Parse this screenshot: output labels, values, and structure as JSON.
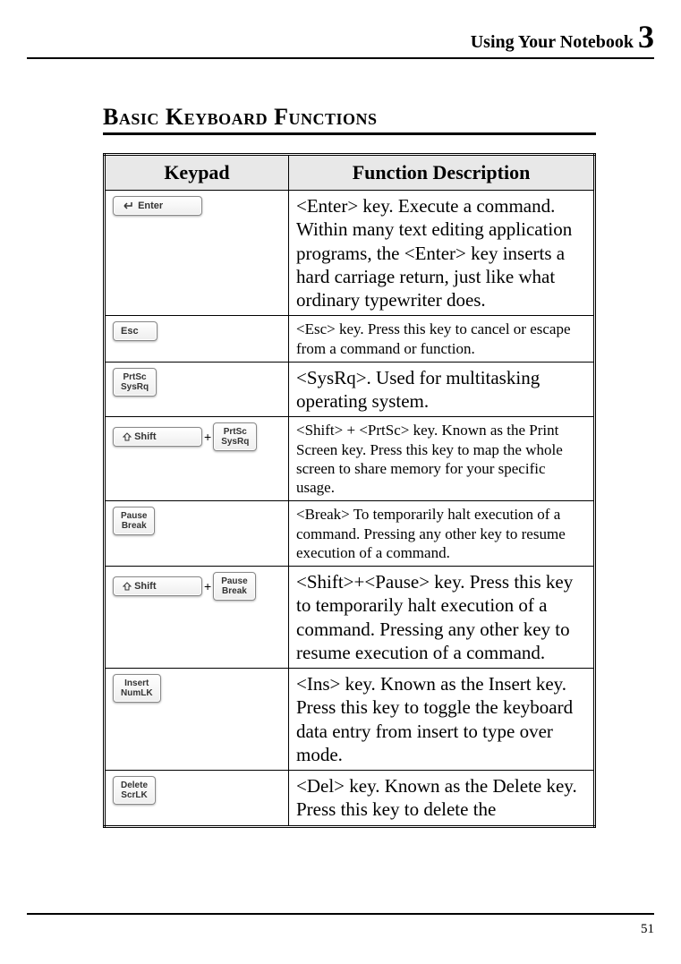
{
  "header": {
    "running_title": "Using Your Notebook",
    "chapter_number": "3"
  },
  "section": {
    "title": "Basic Keyboard Functions"
  },
  "table": {
    "headers": {
      "keypad": "Keypad",
      "desc": "Function Description"
    },
    "rows": [
      {
        "key_labels": [
          "Enter"
        ],
        "size": "large",
        "desc": "<Enter> key. Execute a command. Within many text editing application programs, the <Enter> key inserts a hard carriage return, just like what ordinary typewriter does."
      },
      {
        "key_labels": [
          "Esc"
        ],
        "size": "small",
        "desc": "<Esc> key. Press this key to cancel or escape from a command or function."
      },
      {
        "key_labels": [
          "PrtSc",
          "SysRq"
        ],
        "size": "large",
        "desc": "<SysRq>. Used for multitasking operating system."
      },
      {
        "combo": {
          "left": "Shift",
          "right": [
            "PrtSc",
            "SysRq"
          ]
        },
        "size": "small",
        "desc": "<Shift> + <PrtSc> key. Known as the Print Screen key. Press this key to map the whole screen to share memory for your specific usage."
      },
      {
        "key_labels": [
          "Pause",
          "Break"
        ],
        "size": "small",
        "desc": "<Break> To temporarily halt execution of a command. Pressing any other key to resume execution of a command."
      },
      {
        "combo": {
          "left": "Shift",
          "right": [
            "Pause",
            "Break"
          ]
        },
        "size": "large",
        "desc": "<Shift>+<Pause> key. Press this key to temporarily halt execution of a command. Pressing any other key to resume execution of a command."
      },
      {
        "key_labels": [
          "Insert",
          "NumLK"
        ],
        "size": "large",
        "desc": "<Ins> key. Known as the Insert key. Press this key to toggle the keyboard data entry from insert to type over mode."
      },
      {
        "key_labels": [
          "Delete",
          "ScrLK"
        ],
        "size": "large",
        "desc": "<Del> key. Known as the Delete key. Press this key to delete the"
      }
    ]
  },
  "plus_glyph": "+",
  "page_number": "51"
}
